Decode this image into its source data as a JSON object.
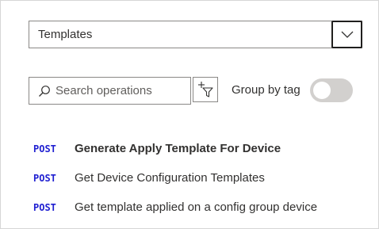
{
  "api_selector": {
    "value": "Templates",
    "toggle_icon": "chevron-down-icon"
  },
  "search": {
    "placeholder": "Search operations",
    "value": "",
    "icon": "search-icon"
  },
  "filter": {
    "icon": "add-filter-icon"
  },
  "group_by_tag": {
    "label": "Group by tag",
    "enabled": false
  },
  "operations": [
    {
      "method": "POST",
      "name": "Generate Apply Template For Device",
      "selected": true
    },
    {
      "method": "POST",
      "name": "Get Device Configuration Templates",
      "selected": false
    },
    {
      "method": "POST",
      "name": "Get template applied on a config group device",
      "selected": false
    }
  ],
  "colors": {
    "method_post": "#1f1fd1",
    "toggle_off": "#d2d0ce",
    "border": "#8a8886"
  }
}
